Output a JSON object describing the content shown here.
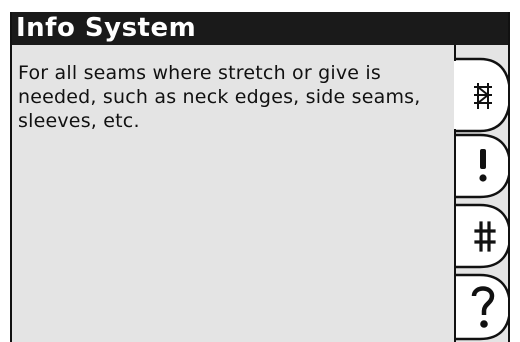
{
  "header": {
    "title": "Info System"
  },
  "content": {
    "description": "For all seams where stretch or give is needed, such as neck edges, side seams, sleeves, etc."
  },
  "tabs": [
    {
      "icon": "stitch-icon",
      "selected": true
    },
    {
      "icon": "exclamation-icon",
      "label": "!"
    },
    {
      "icon": "hash-icon",
      "label": "#"
    },
    {
      "icon": "question-icon",
      "label": "?"
    }
  ],
  "colors": {
    "title_bar_bg": "#1a1a1a",
    "title_text": "#ffffff",
    "screen_bg": "#e4e4e4",
    "tab_bg": "#ffffff",
    "outline": "#111111"
  }
}
